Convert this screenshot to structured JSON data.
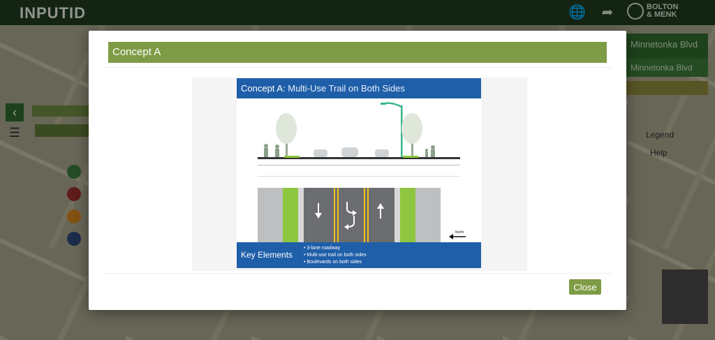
{
  "app": {
    "brand": "INPUTID",
    "partner_line1": "BOLTON",
    "partner_line2": "& MENK"
  },
  "right_panel": {
    "title": "Minnetonka Blvd",
    "subtitle": "Minnetonka Blvd",
    "items": [
      "Legend",
      "Help"
    ]
  },
  "modal": {
    "title": "Concept A",
    "close_label": "Close"
  },
  "concept": {
    "title": "Concept A:",
    "subtitle": "Multi-Use Trail on Both Sides",
    "key_label": "Key Elements",
    "key_items": [
      "3-lane roadway",
      "Multi-use trail on both sides",
      "Boulevards on both sides"
    ],
    "north_label": "North"
  },
  "colors": {
    "header_green": "#7e9b45",
    "concept_blue": "#1f5fa9",
    "trail_green": "#8ec63f"
  }
}
